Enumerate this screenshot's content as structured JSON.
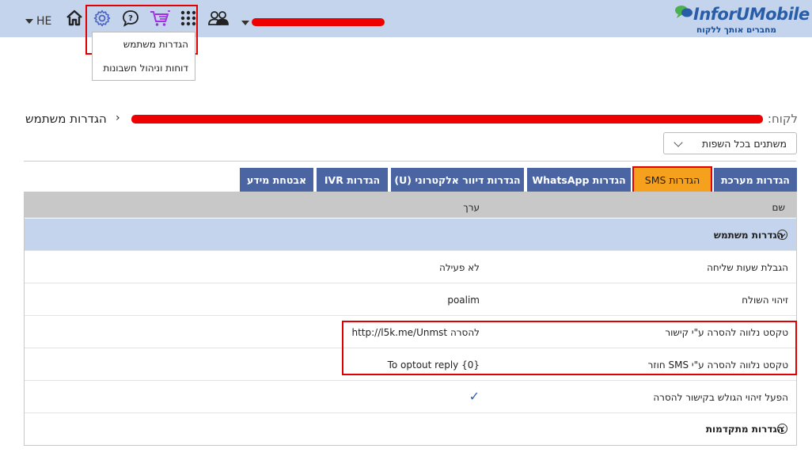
{
  "header": {
    "language": "HE",
    "logo_brand": "InforUMobile",
    "logo_slogan": "מחברים אותך ללקוח",
    "icons": [
      "home-icon",
      "settings-gear-icon",
      "help-chat-icon",
      "cart-icon",
      "apps-grid-icon",
      "users-icon"
    ],
    "menu": {
      "items": [
        "הגדרות משתמש",
        "דוחות וניהול חשבונות"
      ]
    }
  },
  "breadcrumb": {
    "client_label": "לקוח:",
    "page_title": "הגדרות משתמש"
  },
  "language_filter": {
    "selected": "משתנים בכל השפות"
  },
  "tabs": [
    {
      "label": "הגדרות מערכת",
      "active": false
    },
    {
      "label": "הגדרות SMS",
      "active": true
    },
    {
      "label": "הגדרות WhatsApp",
      "active": false
    },
    {
      "label": "הגדרות דיוור אלקטרוני (U)",
      "active": false
    },
    {
      "label": "הגדרות IVR",
      "active": false
    },
    {
      "label": "אבטחת מידע",
      "active": false
    }
  ],
  "table": {
    "headers": {
      "name": "שם",
      "value": "ערך"
    },
    "section_user": "הגדרות משתמש",
    "rows": [
      {
        "name": "הגבלת שעות שליחה",
        "value": "לא פעילה"
      },
      {
        "name": "זיהוי השולח",
        "value": "poalim"
      },
      {
        "name": "טקסט נלווה להסרה ע\"י קישור",
        "value": "להסרה http://l5k.me/Unmst"
      },
      {
        "name": "טקסט נלווה להסרה ע\"י SMS חוזר",
        "value": "To optout reply {0}"
      },
      {
        "name": "הפעל זיהוי הגולש בקישור להסרה",
        "value": "✓"
      }
    ],
    "section_advanced": "הגדרות מתקדמות"
  },
  "colors": {
    "topbar": "#c4d4ed",
    "tab": "#4b65a2",
    "tab_active": "#f5a11d",
    "highlight_red": "#e00000",
    "checkmark": "#3a5ca8"
  }
}
